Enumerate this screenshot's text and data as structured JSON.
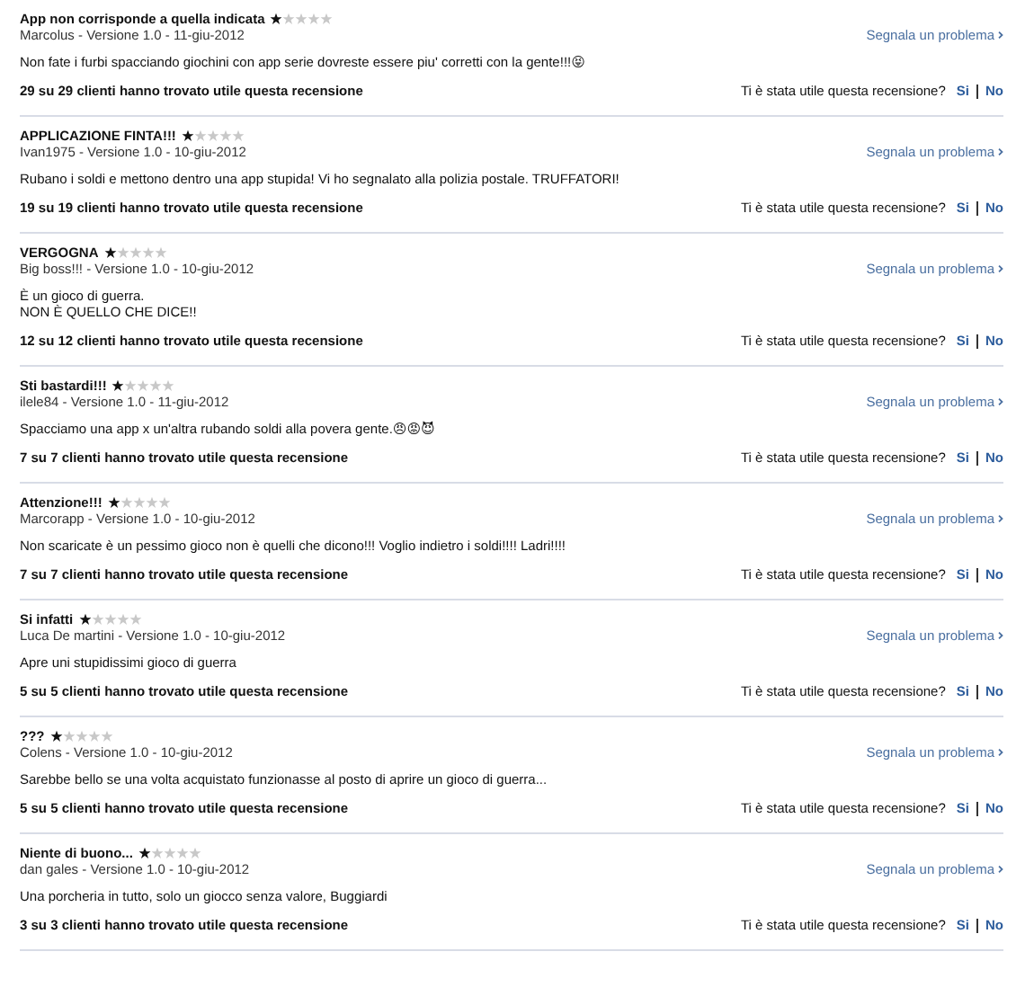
{
  "reviews": [
    {
      "title": "App non corrisponde a quella indicata",
      "stars": 1,
      "meta": "Marcolus - Versione 1.0 - 11-giu-2012",
      "report": "Segnala un problema",
      "body": "Non fate i furbi spacciando giochini con app serie dovreste essere piu' corretti con la gente!!!😝",
      "helpful": "29 su 29 clienti hanno trovato utile questa recensione",
      "question": "Ti è stata utile questa recensione?",
      "yes": "Si",
      "no": "No"
    },
    {
      "title": "APPLICAZIONE FINTA!!!",
      "stars": 1,
      "meta": "Ivan1975 - Versione 1.0 - 10-giu-2012",
      "report": "Segnala un problema",
      "body": "Rubano i soldi e mettono dentro una app stupida! Vi ho segnalato alla polizia postale. TRUFFATORI!",
      "helpful": "19 su 19 clienti hanno trovato utile questa recensione",
      "question": "Ti è stata utile questa recensione?",
      "yes": "Si",
      "no": "No"
    },
    {
      "title": "VERGOGNA",
      "stars": 1,
      "meta": "Big boss!!! - Versione 1.0 - 10-giu-2012",
      "report": "Segnala un problema",
      "body": "È un gioco di guerra.\nNON È QUELLO CHE DICE!!",
      "helpful": "12 su 12 clienti hanno trovato utile questa recensione",
      "question": "Ti è stata utile questa recensione?",
      "yes": "Si",
      "no": "No"
    },
    {
      "title": "Sti bastardi!!!",
      "stars": 1,
      "meta": "ilele84 - Versione 1.0 - 11-giu-2012",
      "report": "Segnala un problema",
      "body": "Spacciamo una app x un'altra rubando soldi alla povera gente.😠😡😈",
      "helpful": "7 su 7 clienti hanno trovato utile questa recensione",
      "question": "Ti è stata utile questa recensione?",
      "yes": "Si",
      "no": "No"
    },
    {
      "title": "Attenzione!!!",
      "stars": 1,
      "meta": "Marcorapp - Versione 1.0 - 10-giu-2012",
      "report": "Segnala un problema",
      "body": "Non scaricate è un pessimo gioco non è quelli che dicono!!! Voglio indietro i soldi!!!! Ladri!!!!",
      "helpful": "7 su 7 clienti hanno trovato utile questa recensione",
      "question": "Ti è stata utile questa recensione?",
      "yes": "Si",
      "no": "No"
    },
    {
      "title": "Si infatti",
      "stars": 1,
      "meta": "Luca De martini - Versione 1.0 - 10-giu-2012",
      "report": "Segnala un problema",
      "body": "Apre uni stupidissimi gioco di guerra",
      "helpful": "5 su 5 clienti hanno trovato utile questa recensione",
      "question": "Ti è stata utile questa recensione?",
      "yes": "Si",
      "no": "No"
    },
    {
      "title": "???",
      "stars": 1,
      "meta": "Colens - Versione 1.0 - 10-giu-2012",
      "report": "Segnala un problema",
      "body": "Sarebbe bello se una volta acquistato funzionasse al posto di aprire un gioco di guerra...",
      "helpful": "5 su 5 clienti hanno trovato utile questa recensione",
      "question": "Ti è stata utile questa recensione?",
      "yes": "Si",
      "no": "No"
    },
    {
      "title": "Niente di buono...",
      "stars": 1,
      "meta": "dan gales - Versione 1.0 - 10-giu-2012",
      "report": "Segnala un problema",
      "body": "Una porcheria in tutto, solo un giocco senza valore, Buggiardi",
      "helpful": "3 su 3 clienti hanno trovato utile questa recensione",
      "question": "Ti è stata utile questa recensione?",
      "yes": "Si",
      "no": "No"
    }
  ]
}
